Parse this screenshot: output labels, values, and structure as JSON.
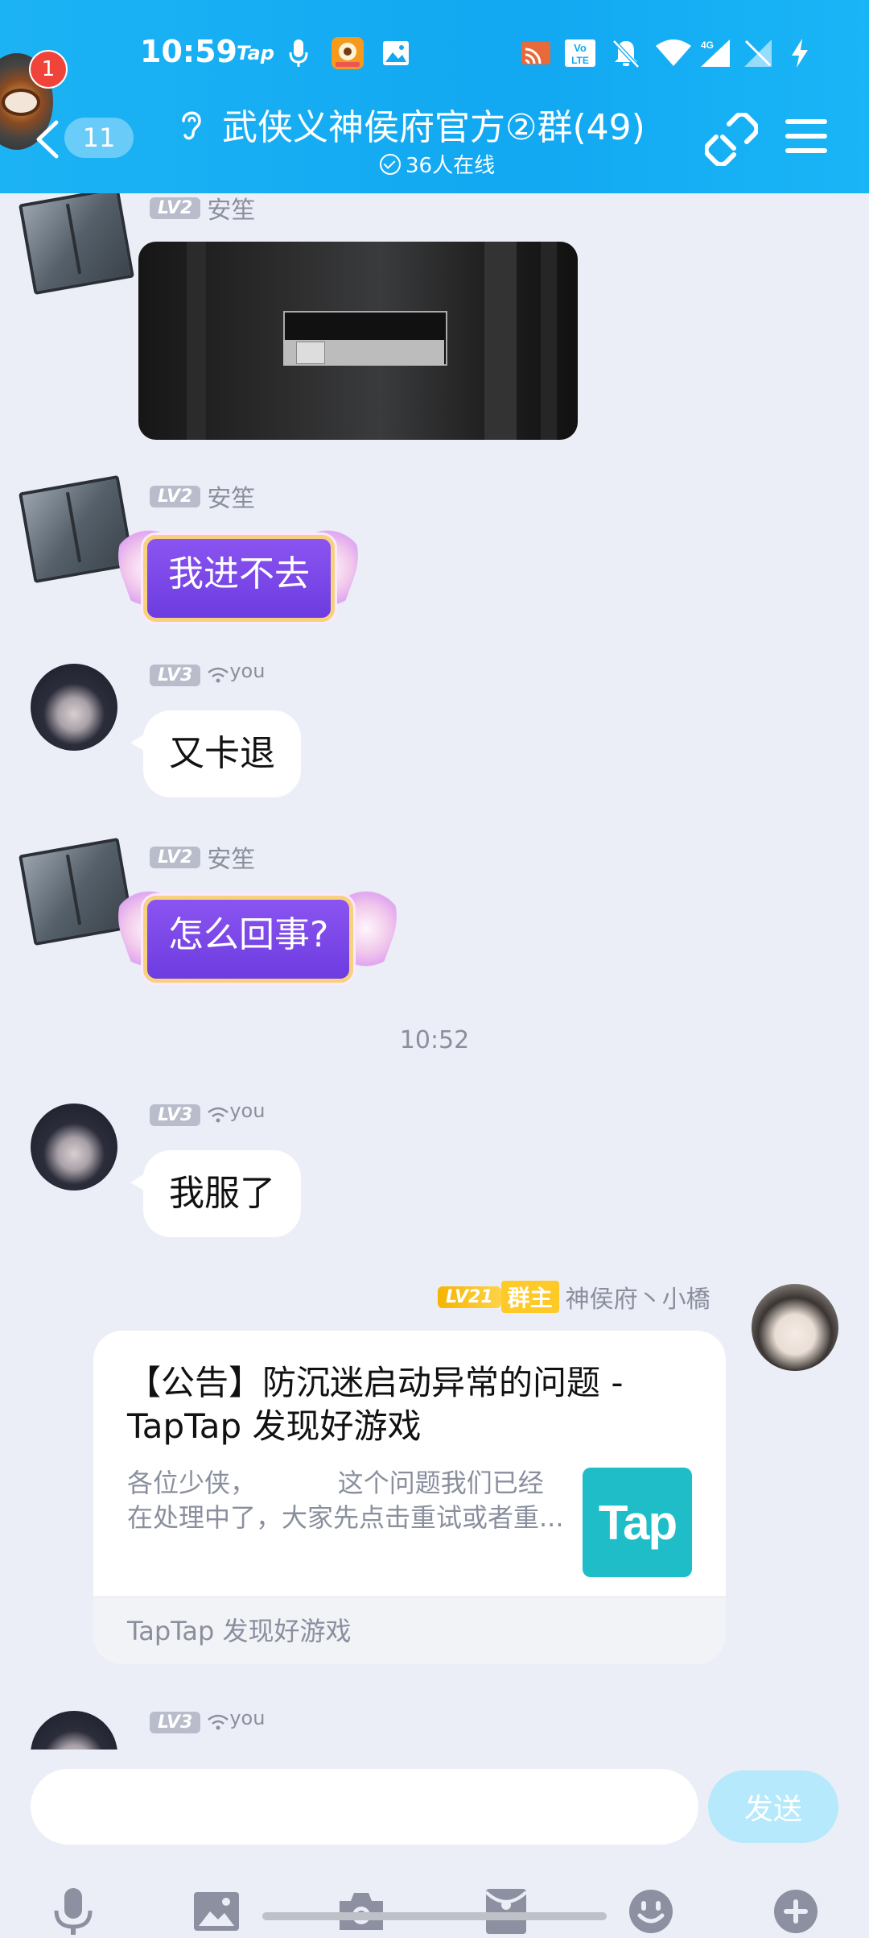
{
  "status_bar": {
    "time": "10:59",
    "app_label": "Tap",
    "icons": [
      "mic-icon",
      "app-icon",
      "gallery-icon",
      "cast-icon",
      "volte-icon",
      "mute-icon",
      "wifi-icon",
      "signal-4g-icon",
      "signal-icon",
      "charging-icon"
    ],
    "network_type": "4G"
  },
  "header": {
    "notification_count": "1",
    "back_count": "11",
    "title": "武侠义神侯府官方②群(49)",
    "online": "36人在线"
  },
  "messages": [
    {
      "user": "安笙",
      "level": "LV2",
      "type": "image"
    },
    {
      "user": "安笙",
      "level": "LV2",
      "type": "text",
      "text": "我进不去"
    },
    {
      "user": "you",
      "level": "LV3",
      "type": "text",
      "text": "又卡退"
    },
    {
      "user": "安笙",
      "level": "LV2",
      "type": "text",
      "text": "怎么回事?"
    },
    {
      "user": "you",
      "level": "LV3",
      "type": "text",
      "text": "我服了"
    },
    {
      "user": "神侯府丶小橋",
      "level": "LV21",
      "role": "群主",
      "type": "card"
    },
    {
      "user": "you",
      "level": "LV3",
      "type": "partial"
    }
  ],
  "timestamp": "10:52",
  "card": {
    "title": "【公告】防沉迷启动异常的问题 - TapTap 发现好游戏",
    "desc": "各位少侠，          这个问题我们已经在处理中了，大家先点击重试或者重...",
    "logo_text": "Tap",
    "source": "TapTap 发现好游戏",
    "logo_color": "#1ebdc8"
  },
  "composer": {
    "placeholder": "",
    "send_label": "发送"
  },
  "toolbar": [
    "mic-icon",
    "image-icon",
    "camera-icon",
    "red-packet-icon",
    "emoji-icon",
    "plus-icon"
  ],
  "colors": {
    "header": "#12a8f2",
    "purple_bubble": "#7a45e8",
    "background": "#eceef7",
    "send_disabled": "#b5e9fb"
  }
}
